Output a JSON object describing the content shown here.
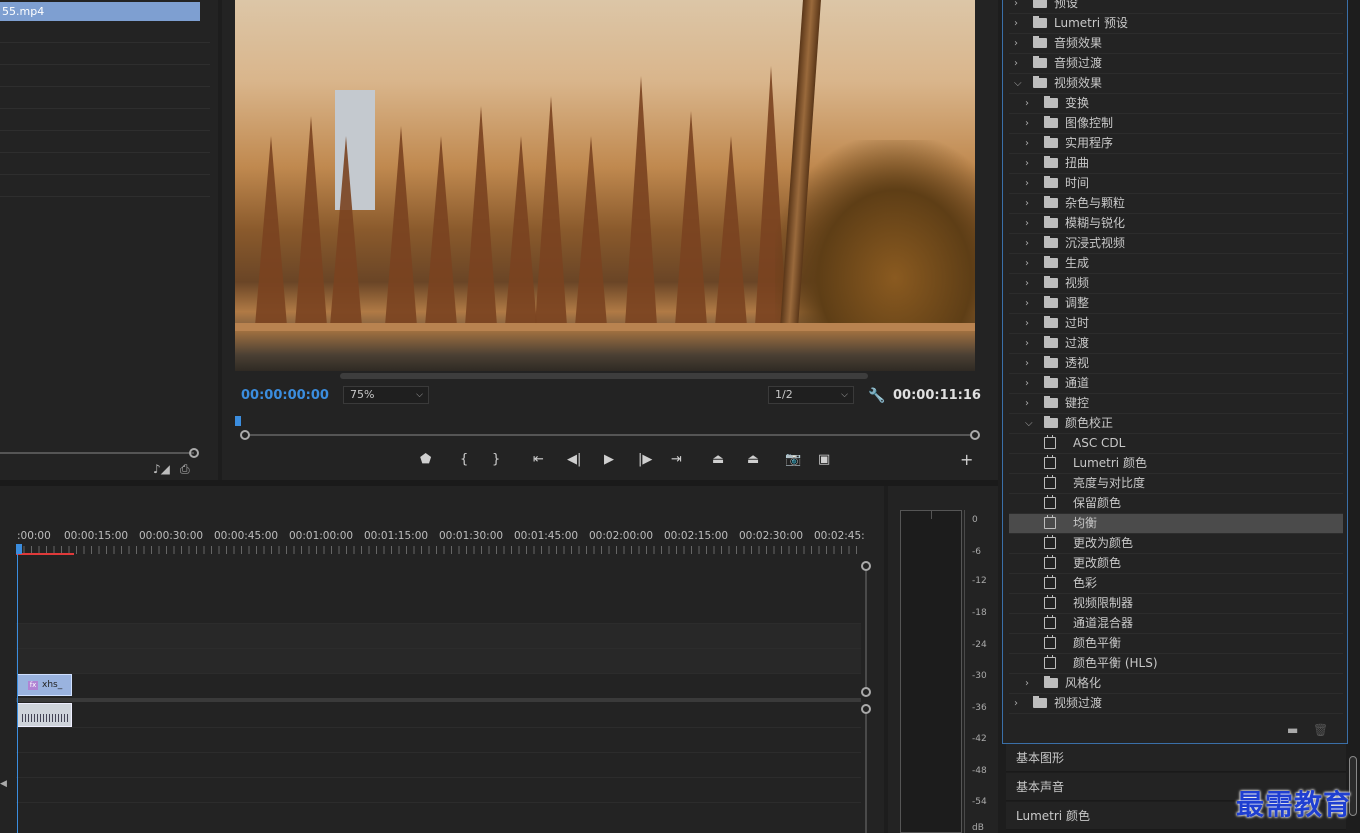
{
  "project": {
    "file_name": "55.mp4"
  },
  "monitor": {
    "timecode_current": "00:00:00:00",
    "zoom": "75%",
    "resolution": "1/2",
    "timecode_duration": "00:00:11:16"
  },
  "timeline": {
    "ticks": [
      ":00:00",
      "00:00:15:00",
      "00:00:30:00",
      "00:00:45:00",
      "00:01:00:00",
      "00:01:15:00",
      "00:01:30:00",
      "00:01:45:00",
      "00:02:00:00",
      "00:02:15:00",
      "00:02:30:00",
      "00:02:45:"
    ],
    "video_clip_label": "xhs_",
    "fx_label": "fx"
  },
  "meters": {
    "labels": [
      "0",
      "-6",
      "-12",
      "-18",
      "-24",
      "-30",
      "-36",
      "-42",
      "-48",
      "-54",
      "dB"
    ]
  },
  "effects": {
    "rows": [
      {
        "label": "预设",
        "level": 0,
        "type": "folder",
        "open": false
      },
      {
        "label": "Lumetri 预设",
        "level": 0,
        "type": "folder",
        "open": false
      },
      {
        "label": "音频效果",
        "level": 0,
        "type": "folder",
        "open": false
      },
      {
        "label": "音频过渡",
        "level": 0,
        "type": "folder",
        "open": false
      },
      {
        "label": "视频效果",
        "level": 0,
        "type": "folder",
        "open": true
      },
      {
        "label": "变换",
        "level": 1,
        "type": "folder",
        "open": false
      },
      {
        "label": "图像控制",
        "level": 1,
        "type": "folder",
        "open": false
      },
      {
        "label": "实用程序",
        "level": 1,
        "type": "folder",
        "open": false
      },
      {
        "label": "扭曲",
        "level": 1,
        "type": "folder",
        "open": false
      },
      {
        "label": "时间",
        "level": 1,
        "type": "folder",
        "open": false
      },
      {
        "label": "杂色与颗粒",
        "level": 1,
        "type": "folder",
        "open": false
      },
      {
        "label": "模糊与锐化",
        "level": 1,
        "type": "folder",
        "open": false
      },
      {
        "label": "沉浸式视频",
        "level": 1,
        "type": "folder",
        "open": false
      },
      {
        "label": "生成",
        "level": 1,
        "type": "folder",
        "open": false
      },
      {
        "label": "视频",
        "level": 1,
        "type": "folder",
        "open": false
      },
      {
        "label": "调整",
        "level": 1,
        "type": "folder",
        "open": false
      },
      {
        "label": "过时",
        "level": 1,
        "type": "folder",
        "open": false
      },
      {
        "label": "过渡",
        "level": 1,
        "type": "folder",
        "open": false
      },
      {
        "label": "透视",
        "level": 1,
        "type": "folder",
        "open": false
      },
      {
        "label": "通道",
        "level": 1,
        "type": "folder",
        "open": false
      },
      {
        "label": "键控",
        "level": 1,
        "type": "folder",
        "open": false
      },
      {
        "label": "颜色校正",
        "level": 1,
        "type": "folder",
        "open": true
      },
      {
        "label": "ASC CDL",
        "level": 2,
        "type": "effect"
      },
      {
        "label": "Lumetri 颜色",
        "level": 2,
        "type": "effect"
      },
      {
        "label": "亮度与对比度",
        "level": 2,
        "type": "effect"
      },
      {
        "label": "保留颜色",
        "level": 2,
        "type": "effect"
      },
      {
        "label": "均衡",
        "level": 2,
        "type": "effect",
        "selected": true
      },
      {
        "label": "更改为颜色",
        "level": 2,
        "type": "effect"
      },
      {
        "label": "更改颜色",
        "level": 2,
        "type": "effect"
      },
      {
        "label": "色彩",
        "level": 2,
        "type": "effect"
      },
      {
        "label": "视频限制器",
        "level": 2,
        "type": "effect"
      },
      {
        "label": "通道混合器",
        "level": 2,
        "type": "effect"
      },
      {
        "label": "颜色平衡",
        "level": 2,
        "type": "effect"
      },
      {
        "label": "颜色平衡 (HLS)",
        "level": 2,
        "type": "effect"
      },
      {
        "label": "风格化",
        "level": 1,
        "type": "folder",
        "open": false
      },
      {
        "label": "视频过渡",
        "level": 0,
        "type": "folder",
        "open": false
      }
    ]
  },
  "lower_panels": [
    "基本图形",
    "基本声音",
    "Lumetri 颜色"
  ],
  "watermark": "最需教育",
  "colors": {
    "accent": "#3b8dde",
    "selected_row": "#4b4b4b",
    "panel_border": "#3a6fa8",
    "watermark": "#1f3fd1"
  }
}
